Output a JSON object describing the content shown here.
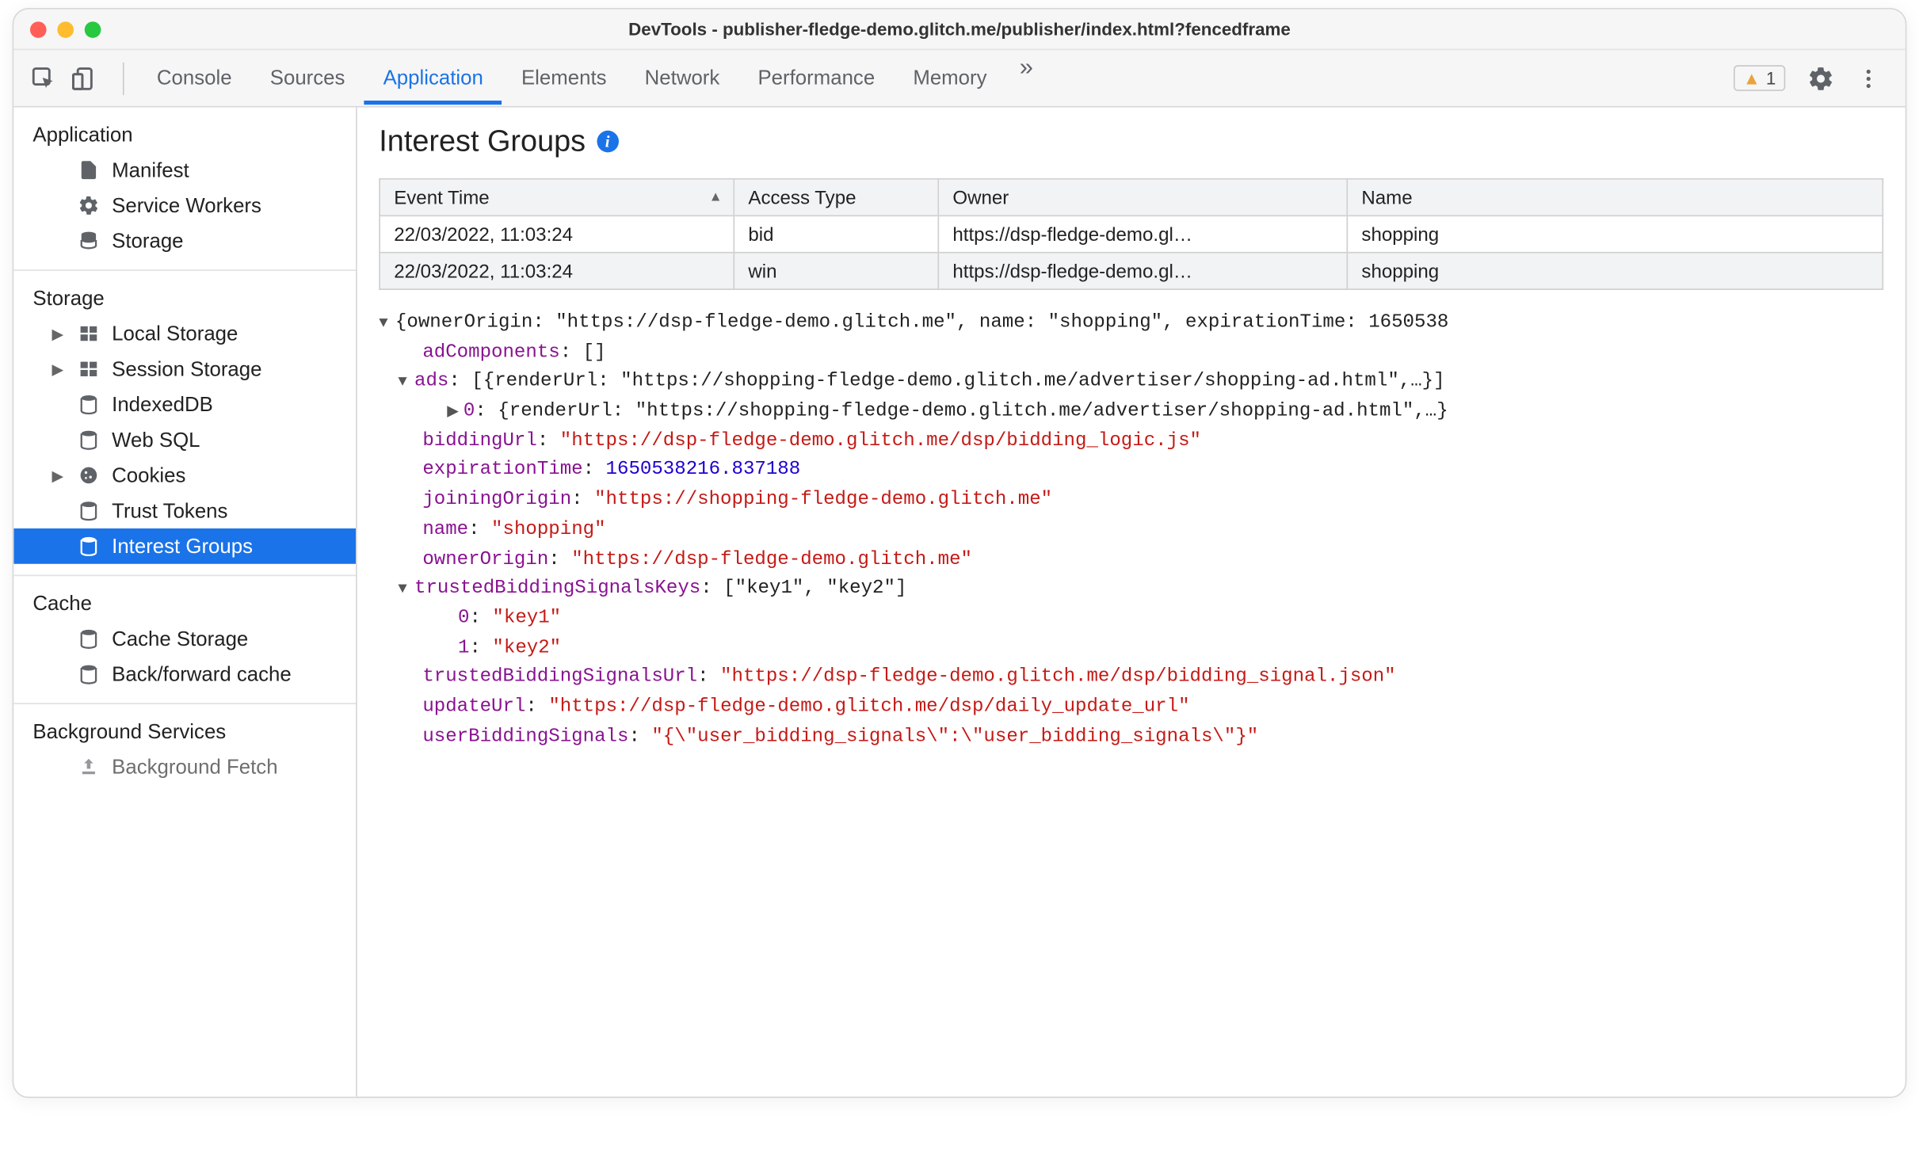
{
  "window": {
    "title": "DevTools - publisher-fledge-demo.glitch.me/publisher/index.html?fencedframe"
  },
  "toolbar": {
    "tabs": [
      "Console",
      "Sources",
      "Application",
      "Elements",
      "Network",
      "Performance",
      "Memory"
    ],
    "active_tab": "Application",
    "more_label": "»",
    "warning_count": "1"
  },
  "sidebar": {
    "sections": [
      {
        "title": "Application",
        "items": [
          {
            "label": "Manifest",
            "icon": "file"
          },
          {
            "label": "Service Workers",
            "icon": "gear"
          },
          {
            "label": "Storage",
            "icon": "db"
          }
        ]
      },
      {
        "title": "Storage",
        "items": [
          {
            "label": "Local Storage",
            "icon": "table",
            "expandable": true
          },
          {
            "label": "Session Storage",
            "icon": "table",
            "expandable": true
          },
          {
            "label": "IndexedDB",
            "icon": "db"
          },
          {
            "label": "Web SQL",
            "icon": "db"
          },
          {
            "label": "Cookies",
            "icon": "cookie",
            "expandable": true
          },
          {
            "label": "Trust Tokens",
            "icon": "db"
          },
          {
            "label": "Interest Groups",
            "icon": "db",
            "selected": true
          }
        ]
      },
      {
        "title": "Cache",
        "items": [
          {
            "label": "Cache Storage",
            "icon": "db"
          },
          {
            "label": "Back/forward cache",
            "icon": "db"
          }
        ]
      },
      {
        "title": "Background Services",
        "items": [
          {
            "label": "Background Fetch",
            "icon": "upload"
          }
        ]
      }
    ]
  },
  "panel": {
    "title": "Interest Groups",
    "columns": [
      "Event Time",
      "Access Type",
      "Owner",
      "Name"
    ],
    "rows": [
      {
        "time": "22/03/2022, 11:03:24",
        "type": "bid",
        "owner": "https://dsp-fledge-demo.gl…",
        "name": "shopping"
      },
      {
        "time": "22/03/2022, 11:03:24",
        "type": "win",
        "owner": "https://dsp-fledge-demo.gl…",
        "name": "shopping"
      }
    ]
  },
  "detail": {
    "headline": "{ownerOrigin: \"https://dsp-fledge-demo.glitch.me\", name: \"shopping\", expirationTime: 1650538",
    "adComponents_key": "adComponents",
    "adComponents_val": "[]",
    "ads_key": "ads",
    "ads_val": "[{renderUrl: \"https://shopping-fledge-demo.glitch.me/advertiser/shopping-ad.html\",…}]",
    "ads_0_key": "0",
    "ads_0_val": "{renderUrl: \"https://shopping-fledge-demo.glitch.me/advertiser/shopping-ad.html\",…}",
    "biddingUrl_key": "biddingUrl",
    "biddingUrl_val": "\"https://dsp-fledge-demo.glitch.me/dsp/bidding_logic.js\"",
    "expirationTime_key": "expirationTime",
    "expirationTime_val": "1650538216.837188",
    "joiningOrigin_key": "joiningOrigin",
    "joiningOrigin_val": "\"https://shopping-fledge-demo.glitch.me\"",
    "name_key": "name",
    "name_val": "\"shopping\"",
    "ownerOrigin_key": "ownerOrigin",
    "ownerOrigin_val": "\"https://dsp-fledge-demo.glitch.me\"",
    "tbsk_key": "trustedBiddingSignalsKeys",
    "tbsk_val": "[\"key1\", \"key2\"]",
    "tbsk_0_key": "0",
    "tbsk_0_val": "\"key1\"",
    "tbsk_1_key": "1",
    "tbsk_1_val": "\"key2\"",
    "tbsu_key": "trustedBiddingSignalsUrl",
    "tbsu_val": "\"https://dsp-fledge-demo.glitch.me/dsp/bidding_signal.json\"",
    "updateUrl_key": "updateUrl",
    "updateUrl_val": "\"https://dsp-fledge-demo.glitch.me/dsp/daily_update_url\"",
    "ubs_key": "userBiddingSignals",
    "ubs_val": "\"{\\\"user_bidding_signals\\\":\\\"user_bidding_signals\\\"}\""
  }
}
